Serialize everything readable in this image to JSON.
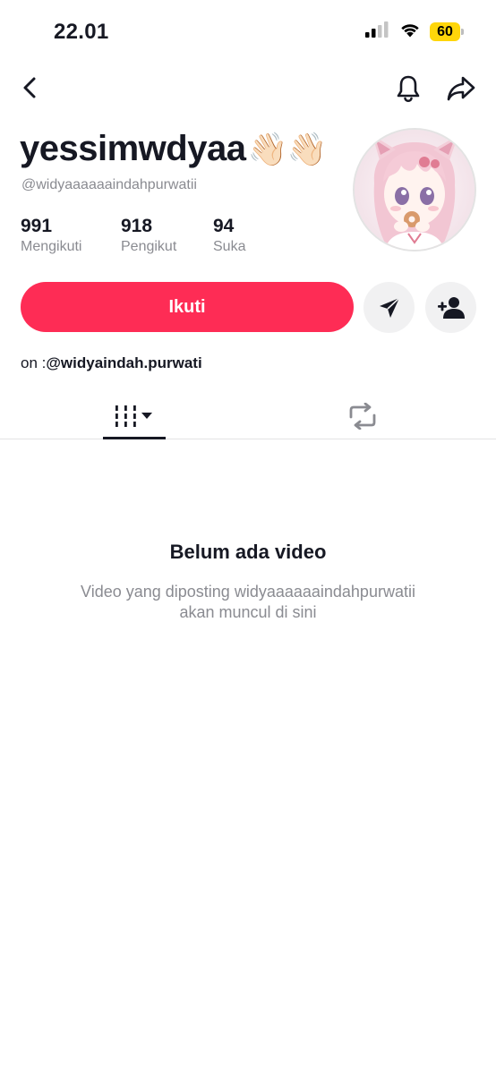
{
  "status_bar": {
    "time": "22.01",
    "battery": "60",
    "signal_icon": "cellular-signal-icon",
    "wifi_icon": "wifi-icon",
    "battery_color": "#ffd60a"
  },
  "nav": {
    "back_icon": "chevron-left-icon",
    "bell_icon": "bell-icon",
    "share_icon": "share-arrow-icon"
  },
  "profile": {
    "display_name": "yessimwdyaa",
    "display_name_emoji": "👋🏻👋🏻",
    "username": "@widyaaaaaaindahpurwatii",
    "avatar_icon": "anime-avatar-image"
  },
  "stats": [
    {
      "value": "991",
      "label": "Mengikuti"
    },
    {
      "value": "918",
      "label": "Pengikut"
    },
    {
      "value": "94",
      "label": "Suka"
    }
  ],
  "actions": {
    "follow_label": "Ikuti",
    "accent_color": "#fe2c55",
    "message_icon": "send-icon",
    "add_friend_icon": "add-user-icon"
  },
  "bio": {
    "prefix": "on :",
    "handle": "@widyaindah.purwati"
  },
  "tabs": {
    "videos_icon": "grid-videos-icon",
    "repost_icon": "repost-icon"
  },
  "empty_state": {
    "title": "Belum ada video",
    "description_line1": "Video yang diposting widyaaaaaaindahpurwatii",
    "description_line2": "akan muncul di sini"
  }
}
